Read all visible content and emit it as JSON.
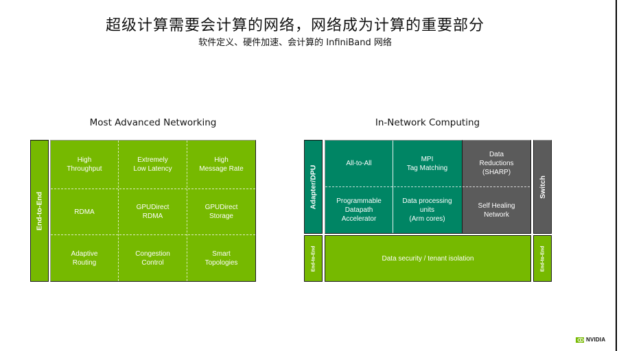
{
  "slide": {
    "title": "超级计算需要会计算的网络，网络成为计算的重要部分",
    "subtitle": "软件定义、硬件加速、会计算的 InfiniBand 网络"
  },
  "left_panel": {
    "title": "Most Advanced Networking",
    "side_label": "End-to-End",
    "cells": [
      [
        "High\nThroughput",
        "Extremely\nLow Latency",
        "High\nMessage Rate"
      ],
      [
        "RDMA",
        "GPUDirect\nRDMA",
        "GPUDirect\nStorage"
      ],
      [
        "Adaptive\nRouting",
        "Congestion\nControl",
        "Smart\nTopologies"
      ]
    ]
  },
  "right_panel": {
    "title": "In-Network Computing",
    "adapter_label": "Adapter/DPU",
    "switch_label": "Switch",
    "left_e2e_label": "End-to-End",
    "right_e2e_label": "End-to-End",
    "adapter_cells": [
      [
        "All-to-All",
        "MPI\nTag Matching"
      ],
      [
        "Programmable\nDatapath\nAccelerator",
        "Data processing\nunits\n(Arm cores)"
      ]
    ],
    "switch_cells": [
      "Data\nReductions\n(SHARP)",
      "Self Healing\nNetwork"
    ],
    "bottom_bar": "Data security / tenant isolation"
  },
  "brand": {
    "logo_text": "NVIDIA",
    "logo_icon": "nvidia-eye-icon"
  },
  "colors": {
    "nvidia_green": "#76b900",
    "teal": "#008564",
    "gray": "#5b5b5b"
  }
}
